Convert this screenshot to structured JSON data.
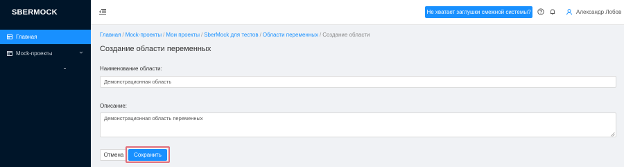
{
  "app": {
    "logo": "SBERMOCK"
  },
  "sidebar": {
    "items": [
      {
        "label": "Главная",
        "icon": "table-icon",
        "active": true
      },
      {
        "label": "Mock-проекты",
        "icon": "table-icon",
        "active": false
      }
    ]
  },
  "header": {
    "help_button": "Не хватает заглушки смежной системы?",
    "user_name": "Александр Лобов"
  },
  "breadcrumb": {
    "items": [
      "Главная",
      "Mock-проекты",
      "Мои проекты",
      "SberMock для тестов",
      "Области переменных"
    ],
    "current": "Создание области",
    "separator": "/"
  },
  "page": {
    "title": "Создание области переменных",
    "name_label": "Наименование области:",
    "name_value": "Демонстрационная область",
    "desc_label": "Описание:",
    "desc_value": "Демонстрационная область переменных",
    "cancel_label": "Отмена",
    "save_label": "Сохранить"
  },
  "colors": {
    "sidebar_bg": "#001529",
    "accent": "#1890ff",
    "highlight": "#e06d7a"
  }
}
